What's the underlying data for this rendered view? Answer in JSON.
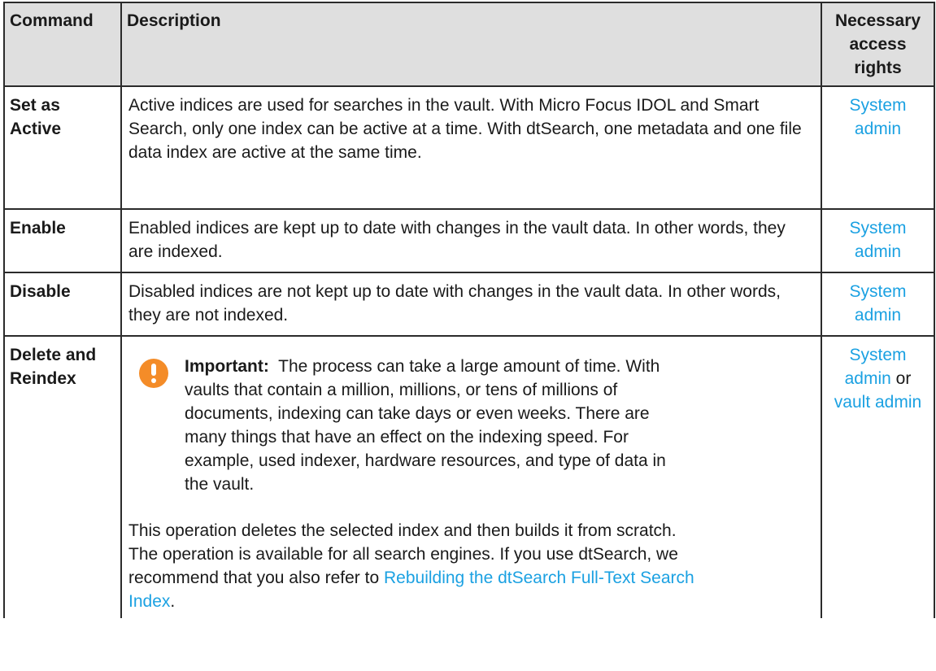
{
  "headers": {
    "command": "Command",
    "description": "Description",
    "rights": "Necessary access rights"
  },
  "rows": [
    {
      "command": "Set as Active",
      "description": "Active indices are used for searches in the vault. With Micro Focus IDOL and Smart Search, only one index can be active at a time. With dtSearch, one metadata and one file data index are active at the same time.",
      "rights_link": "System admin"
    },
    {
      "command": "Enable",
      "description": "Enabled indices are kept up to date with changes in the vault data. In other words, they are indexed.",
      "rights_link": "System admin"
    },
    {
      "command": "Disable",
      "description": "Disabled indices are not kept up to date with changes in the vault data. In other words, they are not indexed.",
      "rights_link": "System admin"
    },
    {
      "command": "Delete and Reindex",
      "note_icon": "exclamation-circle-icon",
      "note_label": "Important:",
      "note_text": "The process can take a large amount of time. With vaults that contain a million, millions, or tens of millions of documents, indexing can take days or even weeks. There are many things that have an effect on the indexing speed. For example, used indexer, hardware resources, and type of data in the vault.",
      "description_main": "This operation deletes the selected index and then builds it from scratch. The operation is available for all search engines. If you use dtSearch, we recommend that you also refer to",
      "description_link": "Rebuilding the dtSearch Full-Text Search Index",
      "description_end": ".",
      "rights_link": "System admin",
      "rights_or": "or",
      "rights_link2": "vault admin"
    }
  ],
  "colors": {
    "header_bg": "#dfdfdf",
    "link": "#1ba1e2",
    "note_icon": "#f48c28",
    "border": "#2b2b2b"
  }
}
